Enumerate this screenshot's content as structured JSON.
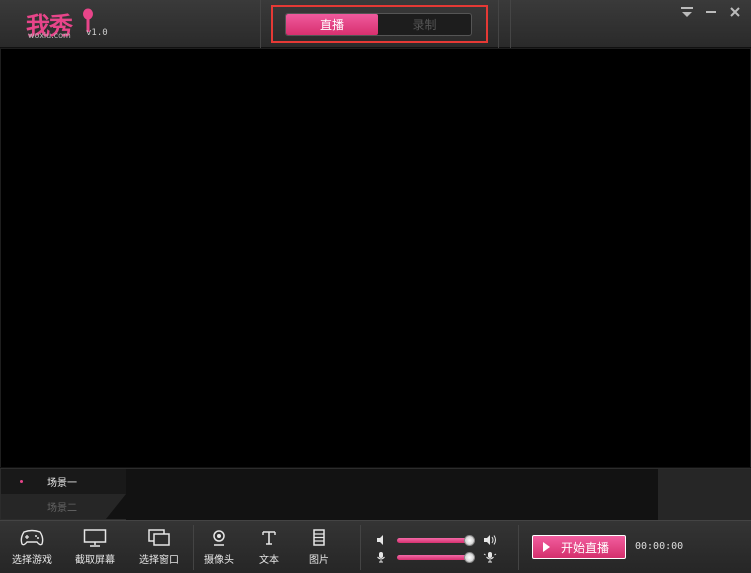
{
  "app": {
    "brand": "我秀",
    "domain": "woxiu.com",
    "version": "v1.0"
  },
  "mode_toggle": {
    "options": [
      "直播",
      "录制"
    ],
    "selected": "直播"
  },
  "window_controls": {
    "menu_icon": "dropdown-menu-icon",
    "minimize_icon": "minimize-icon",
    "close_icon": "close-icon"
  },
  "scenes": {
    "items": [
      {
        "label": "场景一",
        "active": true
      },
      {
        "label": "场景二",
        "active": false
      }
    ]
  },
  "toolbar": {
    "select_game": {
      "label": "选择游戏",
      "icon": "gamepad-icon"
    },
    "capture_screen": {
      "label": "截取屏幕",
      "icon": "monitor-icon"
    },
    "select_window": {
      "label": "选择窗口",
      "icon": "windows-icon"
    },
    "camera": {
      "label": "摄像头",
      "icon": "webcam-icon"
    },
    "text": {
      "label": "文本",
      "icon": "text-icon"
    },
    "image": {
      "label": "图片",
      "icon": "image-film-icon"
    }
  },
  "audio": {
    "speaker_volume": 1.0,
    "microphone_volume": 1.0
  },
  "broadcast": {
    "start_label": "开始直播",
    "elapsed": "00:00:00"
  },
  "colors": {
    "accent": "#e8458a",
    "highlight_frame": "#e53935",
    "background": "#2a2a2a",
    "preview": "#000000"
  }
}
